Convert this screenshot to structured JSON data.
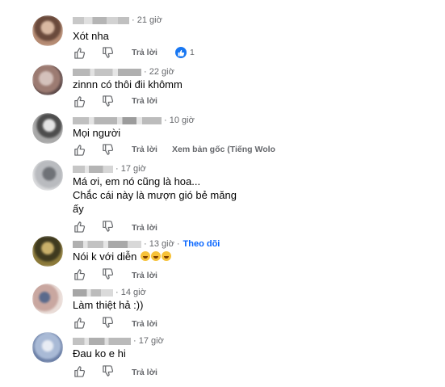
{
  "comments": [
    {
      "time": "· 21 giờ",
      "text": "Xót nha",
      "reply": "Trả lời",
      "reactions": "1",
      "avatar_colors": [
        "#b58b73",
        "#6a4a3c",
        "#d9b9a2"
      ]
    },
    {
      "time": "· 22 giờ",
      "text": "zinnn có thôi đii khômm",
      "reply": "Trả lời",
      "avatar_colors": [
        "#9c7b72",
        "#d4c1bb",
        "#5e4a49"
      ]
    },
    {
      "time": "· 10 giờ",
      "text": "Mọi người",
      "reply": "Trả lời",
      "translate": "Xem bản gốc (Tiếng Wolo",
      "avatar_colors": [
        "#a8a8a8",
        "#4d4d4d",
        "#e4e4e4"
      ]
    },
    {
      "time": "· 17 giờ",
      "lines": [
        "Má ơi, em nó cũng là hoa...",
        "Chắc cái này là mượn gió bẻ măng",
        "ấy"
      ],
      "reply": "Trả lời",
      "avatar_colors": [
        "#b9bbbf",
        "#6f7277",
        "#d9dadc"
      ]
    },
    {
      "time": "· 13 giờ ·",
      "follow": "Theo dõi",
      "text": "Nói k với diễn",
      "reply": "Trả lời",
      "avatar_colors": [
        "#8c7a3a",
        "#3f3a1f",
        "#c9b06a"
      ]
    },
    {
      "time": "· 14 giờ",
      "text": "Làm thiệt hả :))",
      "reply": "Trả lời",
      "avatar_colors": [
        "#c9a7a0",
        "#5a6a8c",
        "#e9dcd7"
      ]
    },
    {
      "time": "· 17 giờ",
      "text": "Đau ko e hi",
      "reply": "Trả lời",
      "avatar_colors": [
        "#a9bad6",
        "#e8ecf4",
        "#6b7fa6"
      ]
    }
  ]
}
